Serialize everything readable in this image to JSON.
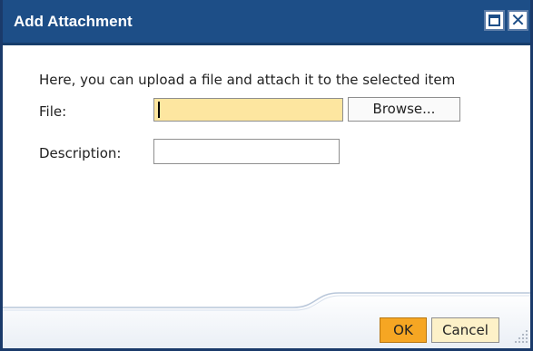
{
  "dialog": {
    "title": "Add Attachment",
    "instruction": "Here, you can upload a file and attach it to the selected item"
  },
  "form": {
    "file_label": "File:",
    "file_value": "",
    "browse_label": "Browse...",
    "description_label": "Description:",
    "description_value": ""
  },
  "footer": {
    "ok_label": "OK",
    "cancel_label": "Cancel"
  },
  "icons": {
    "maximize": "maximize-icon",
    "close": "close-icon",
    "resize": "resize-grip-icon"
  },
  "colors": {
    "titlebar": "#1d4e87",
    "file_input_bg": "#fde6a0",
    "ok_button": "#f6a623",
    "cancel_button": "#fdf1c8"
  }
}
